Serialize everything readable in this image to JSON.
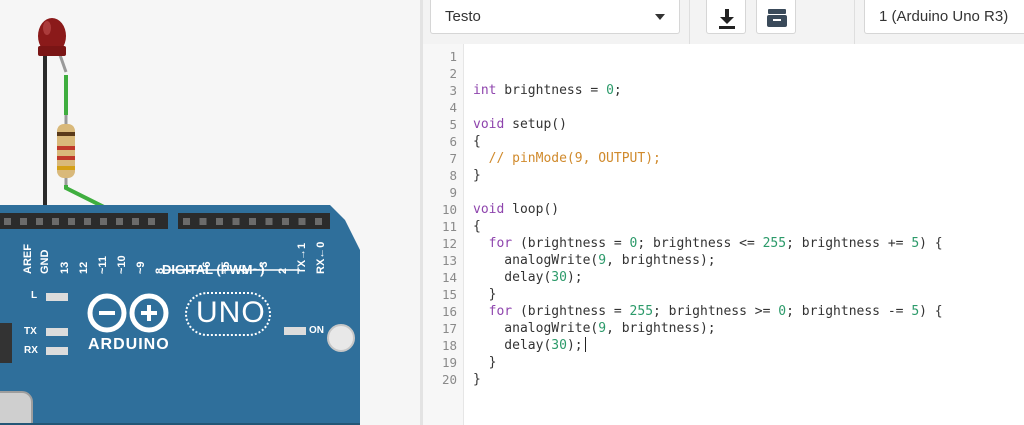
{
  "toolbar": {
    "mode_label": "Testo",
    "device_label": "1 (Arduino Uno R3)",
    "download_icon": "download-icon",
    "library_icon": "library-icon"
  },
  "board": {
    "pins_power": [
      "AREF",
      "GND"
    ],
    "pins_digital": [
      "13",
      "12",
      "~11",
      "~10",
      "~9",
      "8",
      "7",
      "~6",
      "~5",
      "4",
      "~3",
      "2",
      "TX→1",
      "RX←0"
    ],
    "digital_label": "DIGITAL (PWM~)",
    "led_labels": [
      "L",
      "TX",
      "RX",
      "ON"
    ],
    "brand": "ARDUINO",
    "model": "UNO",
    "colors": {
      "board": "#2f6f9b",
      "header": "#2b2b2b",
      "led": "#8b1a1a",
      "wire_green": "#3fae3f",
      "resistor": "#d9b97a"
    }
  },
  "code": {
    "line_numbers": [
      "1",
      "2",
      "3",
      "4",
      "5",
      "6",
      "7",
      "8",
      "9",
      "10",
      "11",
      "12",
      "13",
      "14",
      "15",
      "16",
      "17",
      "18",
      "19",
      "20"
    ]
  }
}
